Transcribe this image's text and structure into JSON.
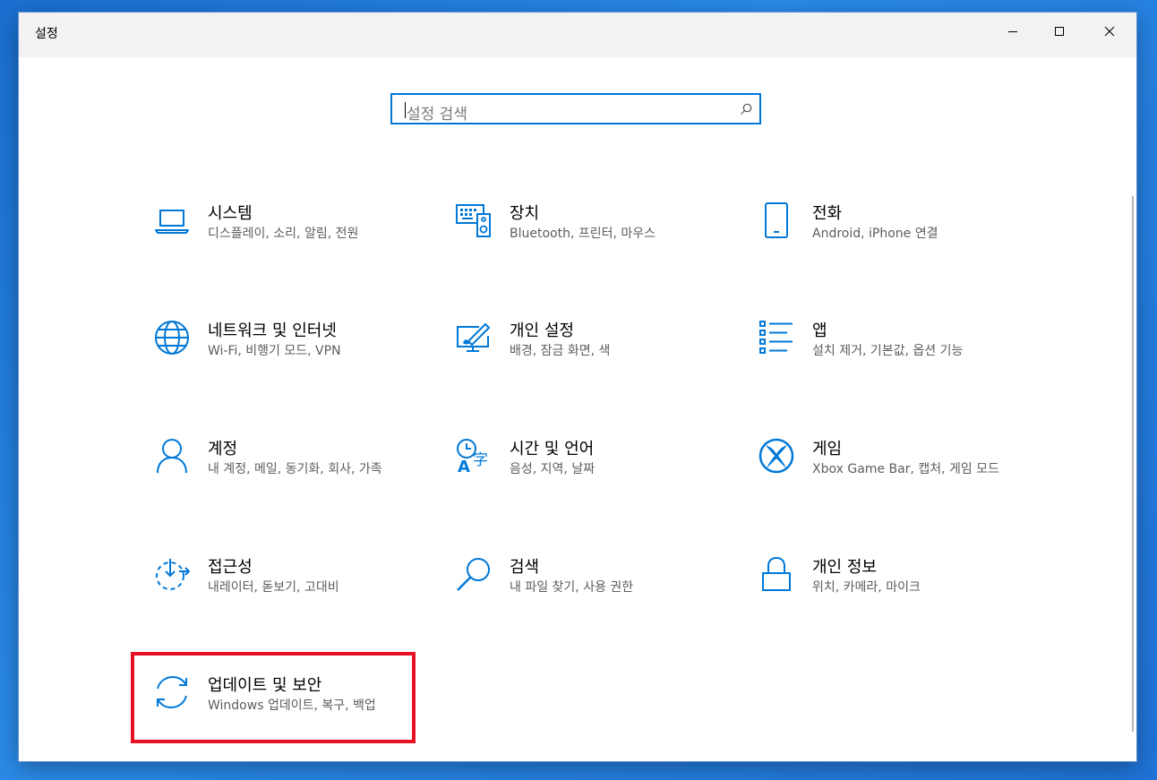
{
  "window": {
    "title": "설정"
  },
  "search": {
    "placeholder": "설정 검색"
  },
  "categories": [
    {
      "label": "시스템",
      "desc": "디스플레이, 소리, 알림, 전원",
      "icon": "laptop-icon"
    },
    {
      "label": "장치",
      "desc": "Bluetooth, 프린터, 마우스",
      "icon": "devices-icon"
    },
    {
      "label": "전화",
      "desc": "Android, iPhone 연결",
      "icon": "phone-icon"
    },
    {
      "label": "네트워크 및 인터넷",
      "desc": "Wi-Fi, 비행기 모드, VPN",
      "icon": "globe-icon"
    },
    {
      "label": "개인 설정",
      "desc": "배경, 잠금 화면, 색",
      "icon": "paint-icon"
    },
    {
      "label": "앱",
      "desc": "설치 제거, 기본값, 옵션 기능",
      "icon": "apps-list-icon"
    },
    {
      "label": "계정",
      "desc": "내 계정, 메일, 동기화, 회사, 가족",
      "icon": "person-icon"
    },
    {
      "label": "시간 및 언어",
      "desc": "음성, 지역, 날짜",
      "icon": "time-language-icon"
    },
    {
      "label": "게임",
      "desc": "Xbox Game Bar, 캡처, 게임 모드",
      "icon": "xbox-icon"
    },
    {
      "label": "접근성",
      "desc": "내레이터, 돋보기, 고대비",
      "icon": "ease-of-access-icon"
    },
    {
      "label": "검색",
      "desc": "내 파일 찾기, 사용 권한",
      "icon": "search-icon"
    },
    {
      "label": "개인 정보",
      "desc": "위치, 카메라, 마이크",
      "icon": "lock-icon"
    },
    {
      "label": "업데이트 및 보안",
      "desc": "Windows 업데이트, 복구, 백업",
      "icon": "sync-icon"
    }
  ],
  "colors": {
    "accent": "#0078d7",
    "highlight": "#e81123"
  }
}
